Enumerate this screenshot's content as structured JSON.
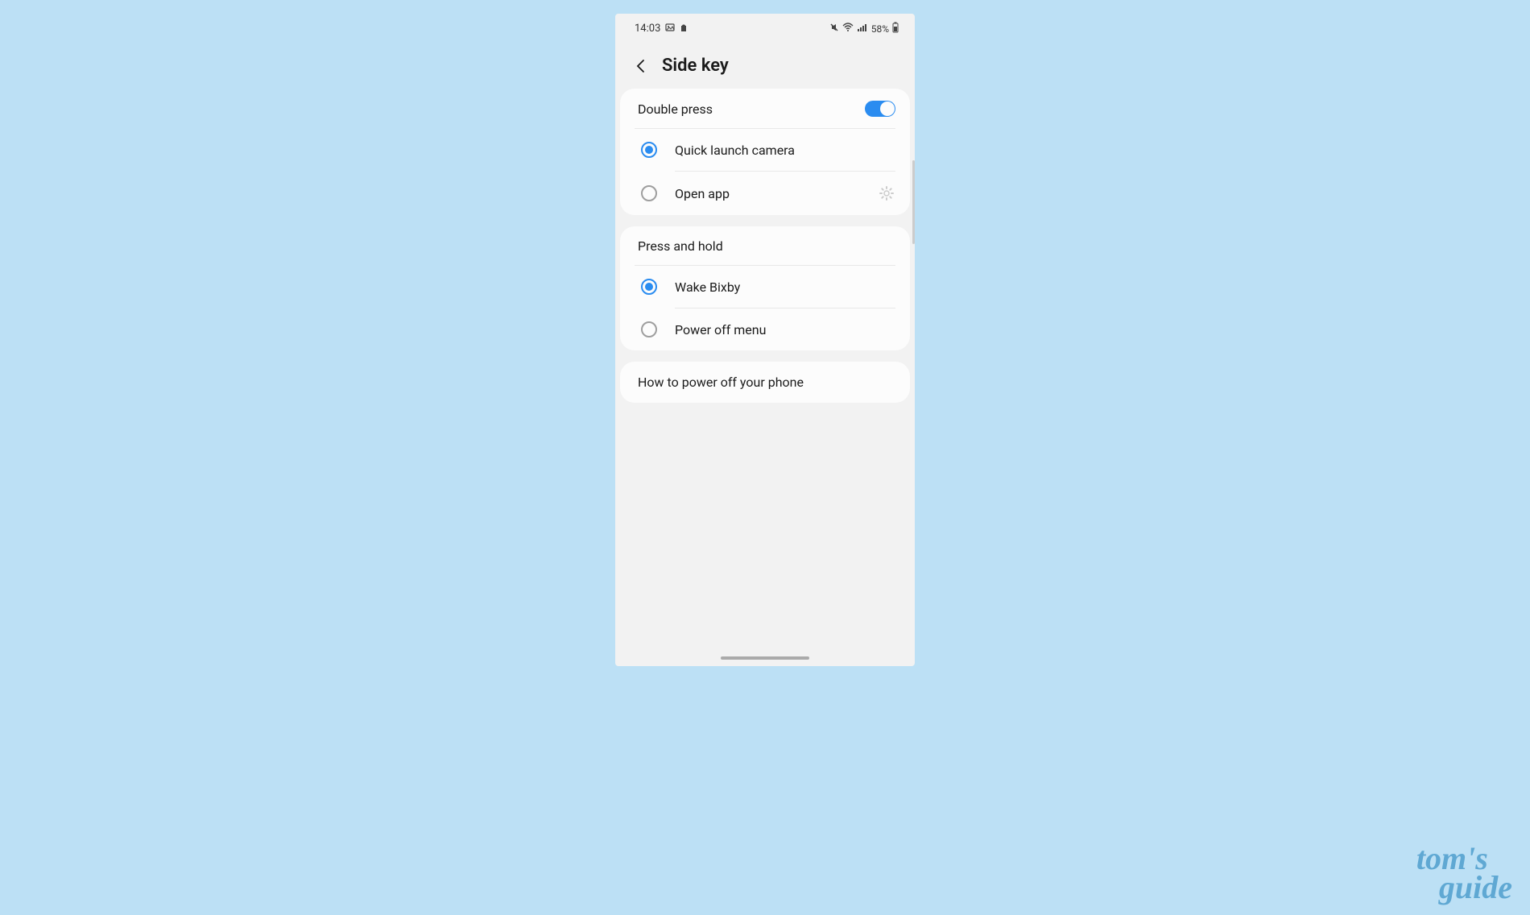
{
  "statusBar": {
    "time": "14:03",
    "batteryPercent": "58%"
  },
  "header": {
    "title": "Side key"
  },
  "doublePress": {
    "title": "Double press",
    "toggleOn": true,
    "options": [
      {
        "label": "Quick launch camera",
        "selected": true
      },
      {
        "label": "Open app",
        "selected": false,
        "hasSettings": true
      }
    ]
  },
  "pressAndHold": {
    "title": "Press and hold",
    "options": [
      {
        "label": "Wake Bixby",
        "selected": true
      },
      {
        "label": "Power off menu",
        "selected": false
      }
    ]
  },
  "helpLink": {
    "label": "How to power off your phone"
  },
  "watermark": {
    "line1": "tom's",
    "line2": "guide"
  }
}
